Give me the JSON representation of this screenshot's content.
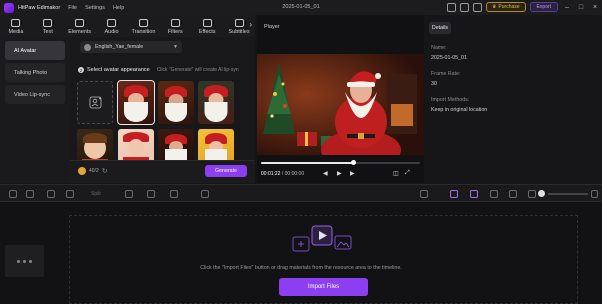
{
  "app": {
    "name": "HitPaw Edimakor",
    "menus": [
      "File",
      "Settings",
      "Help"
    ],
    "document_title": "2025-01-05_01",
    "purchase_label": "Purchase",
    "export_label": "Export"
  },
  "toolbar": {
    "tools": [
      {
        "label": "Media",
        "icon": "media-icon"
      },
      {
        "label": "Text",
        "icon": "text-icon"
      },
      {
        "label": "Elements",
        "icon": "elements-icon"
      },
      {
        "label": "Audio",
        "icon": "audio-icon"
      },
      {
        "label": "Transition",
        "icon": "transition-icon"
      },
      {
        "label": "Filters",
        "icon": "filters-icon"
      },
      {
        "label": "Effects",
        "icon": "effects-icon"
      },
      {
        "label": "Subtitles",
        "icon": "subtitles-icon"
      }
    ],
    "more_glyph": "›"
  },
  "sidebar": {
    "items": [
      {
        "label": "AI Avatar",
        "active": true
      },
      {
        "label": "Talking Photo",
        "active": false
      },
      {
        "label": "Video Lip-sync",
        "active": false
      }
    ]
  },
  "avatar_panel": {
    "voice_selected": "English_Yae_female",
    "step_number": "2",
    "step_title": "Select avatar appearance",
    "step_hint": "Click \"Generate\" will create AI lip-syn",
    "credits": "40/2",
    "generate_label": "Generate"
  },
  "player": {
    "label": "Player",
    "current_time": "00:01:22",
    "total_time": "00:00:00",
    "progress_fraction": 0.58
  },
  "details": {
    "tab_label": "Details",
    "name_label": "Name:",
    "name_value": "2025-01-05_01",
    "frame_rate_label": "Frame Rate:",
    "frame_rate_value": "30",
    "import_method_label": "Import Methods:",
    "import_method_value": "Keep in original location"
  },
  "timeline": {
    "split_label": "Split",
    "empty_message": "Click the \"Import Files\" button or drag materials from the resource area to the timeline.",
    "import_button_label": "Import Files"
  },
  "colors": {
    "accent": "#8c3ff0",
    "purchase_gold": "#e5b84f",
    "santa_red": "#c51e21"
  }
}
